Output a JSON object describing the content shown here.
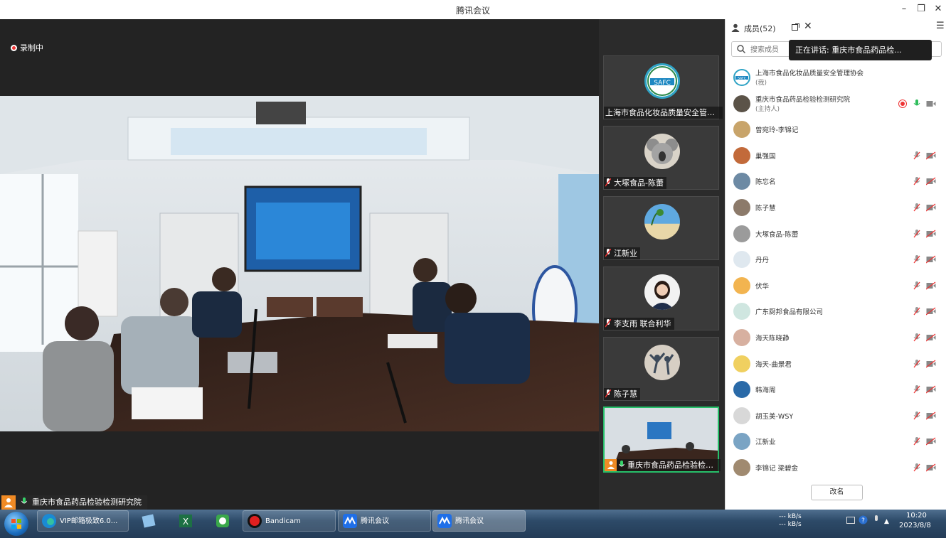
{
  "window": {
    "title": "腾讯会议",
    "minimize_icon": "minimize-icon",
    "maximize_icon": "restore-icon",
    "close_icon": "close-icon"
  },
  "main_video": {
    "recording_label": "录制中",
    "speaker_name": "重庆市食品药品检验检测研究院"
  },
  "thumbnails": [
    {
      "label": "上海市食品化妆品质量安全管理协...",
      "avatar_text": "SAFC",
      "mic": false
    },
    {
      "label": "大塚食品-陈蕾",
      "mic": true
    },
    {
      "label": "江新业",
      "mic": true
    },
    {
      "label": "李支雨 联合利华",
      "mic": true
    },
    {
      "label": "陈子慧",
      "mic": true
    },
    {
      "label": "重庆市食品药品检验检测...",
      "mic": true,
      "active": true
    }
  ],
  "panel": {
    "title": "成员(52)",
    "search_placeholder": "搜索成员",
    "speaking_tooltip": "正在讲话:  重庆市食品药品检...",
    "rename_label": "改名",
    "members": [
      {
        "name": "上海市食品化妆品质量安全管理协会",
        "sub": "(我)",
        "avatar": "SAFC"
      },
      {
        "name": "重庆市食品药品检验检测研究院",
        "sub": "(主持人)",
        "recording": true,
        "mic_on": true
      },
      {
        "name": "曾宛玲-李锦记"
      },
      {
        "name": "巢强国",
        "muted": true
      },
      {
        "name": "陈忘名",
        "muted": true
      },
      {
        "name": "陈子慧",
        "muted": true
      },
      {
        "name": "大塚食品-陈蕾",
        "muted": true
      },
      {
        "name": "丹丹",
        "muted": true
      },
      {
        "name": "伏华",
        "muted": true
      },
      {
        "name": "广东厨邦食品有限公司",
        "muted": true
      },
      {
        "name": "海天陈晓静",
        "muted": true
      },
      {
        "name": "海天-曲景君",
        "muted": true
      },
      {
        "name": "韩海周",
        "muted": true
      },
      {
        "name": "胡玉美-WSY",
        "muted": true
      },
      {
        "name": "江新业",
        "muted": true
      },
      {
        "name": "李锦记 梁碧金",
        "muted": true
      }
    ]
  },
  "taskbar": {
    "items": [
      {
        "label": "VIP邮箱极致6.0...",
        "icon": "edge-icon"
      },
      {
        "label": "",
        "icon": "notepad-icon"
      },
      {
        "label": "",
        "icon": "excel-icon"
      },
      {
        "label": "",
        "icon": "cloud-app-icon"
      },
      {
        "label": "Bandicam",
        "icon": "bandicam-icon"
      },
      {
        "label": "腾讯会议",
        "icon": "tencent-meeting-icon"
      },
      {
        "label": "腾讯会议",
        "icon": "tencent-meeting-icon"
      }
    ],
    "net_up": "--- kB/s",
    "net_down": "--- kB/s",
    "time": "10:20",
    "date": "2023/8/8"
  }
}
